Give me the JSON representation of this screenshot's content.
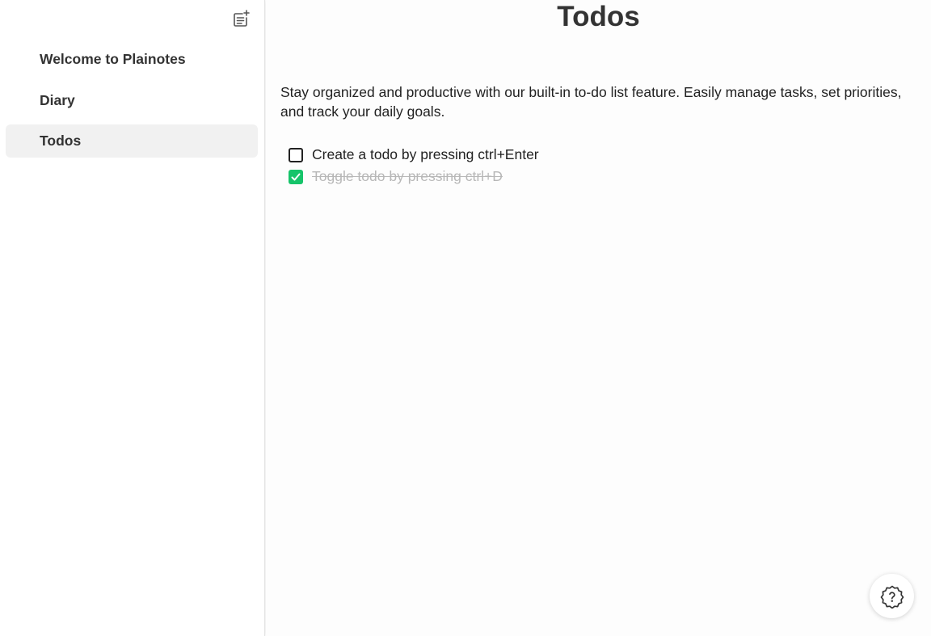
{
  "sidebar": {
    "new_note_icon": "note-add-icon",
    "items": [
      {
        "label": "Welcome to Plainotes",
        "active": false
      },
      {
        "label": "Diary",
        "active": false
      },
      {
        "label": "Todos",
        "active": true
      }
    ]
  },
  "main": {
    "title": "Todos",
    "description": "Stay organized and productive with our built-in to-do list feature. Easily manage tasks, set priorities, and track your daily goals.",
    "todos": [
      {
        "text": "Create a todo by pressing ctrl+Enter",
        "checked": false
      },
      {
        "text": "Toggle todo by pressing ctrl+D",
        "checked": true
      }
    ]
  },
  "help_button": {
    "icon": "help-icon"
  },
  "colors": {
    "accent_check": "#16c46a",
    "active_item_bg": "#f1f1f1",
    "done_text": "#b7b7b7"
  }
}
